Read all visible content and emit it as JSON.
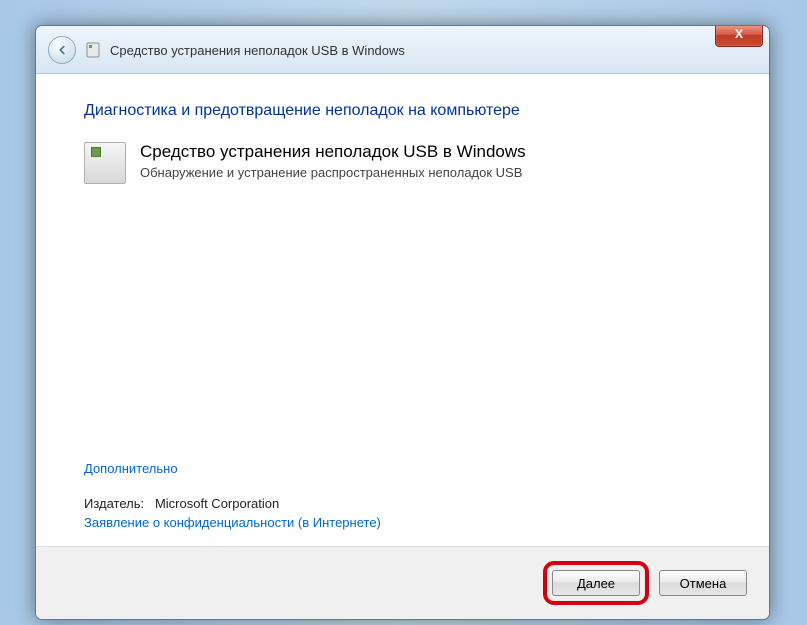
{
  "window": {
    "title": "Средство устранения неполадок USB в Windows",
    "close_glyph": "X"
  },
  "content": {
    "heading": "Диагностика и предотвращение неполадок на компьютере",
    "troubleshooter": {
      "title": "Средство устранения неполадок USB в Windows",
      "description": "Обнаружение и устранение распространенных неполадок USB"
    },
    "advanced_link": "Дополнительно",
    "publisher_label": "Издатель:",
    "publisher_value": "Microsoft Corporation",
    "privacy_link": "Заявление о конфиденциальности (в Интернете)"
  },
  "footer": {
    "next_label": "Далее",
    "cancel_label": "Отмена"
  }
}
